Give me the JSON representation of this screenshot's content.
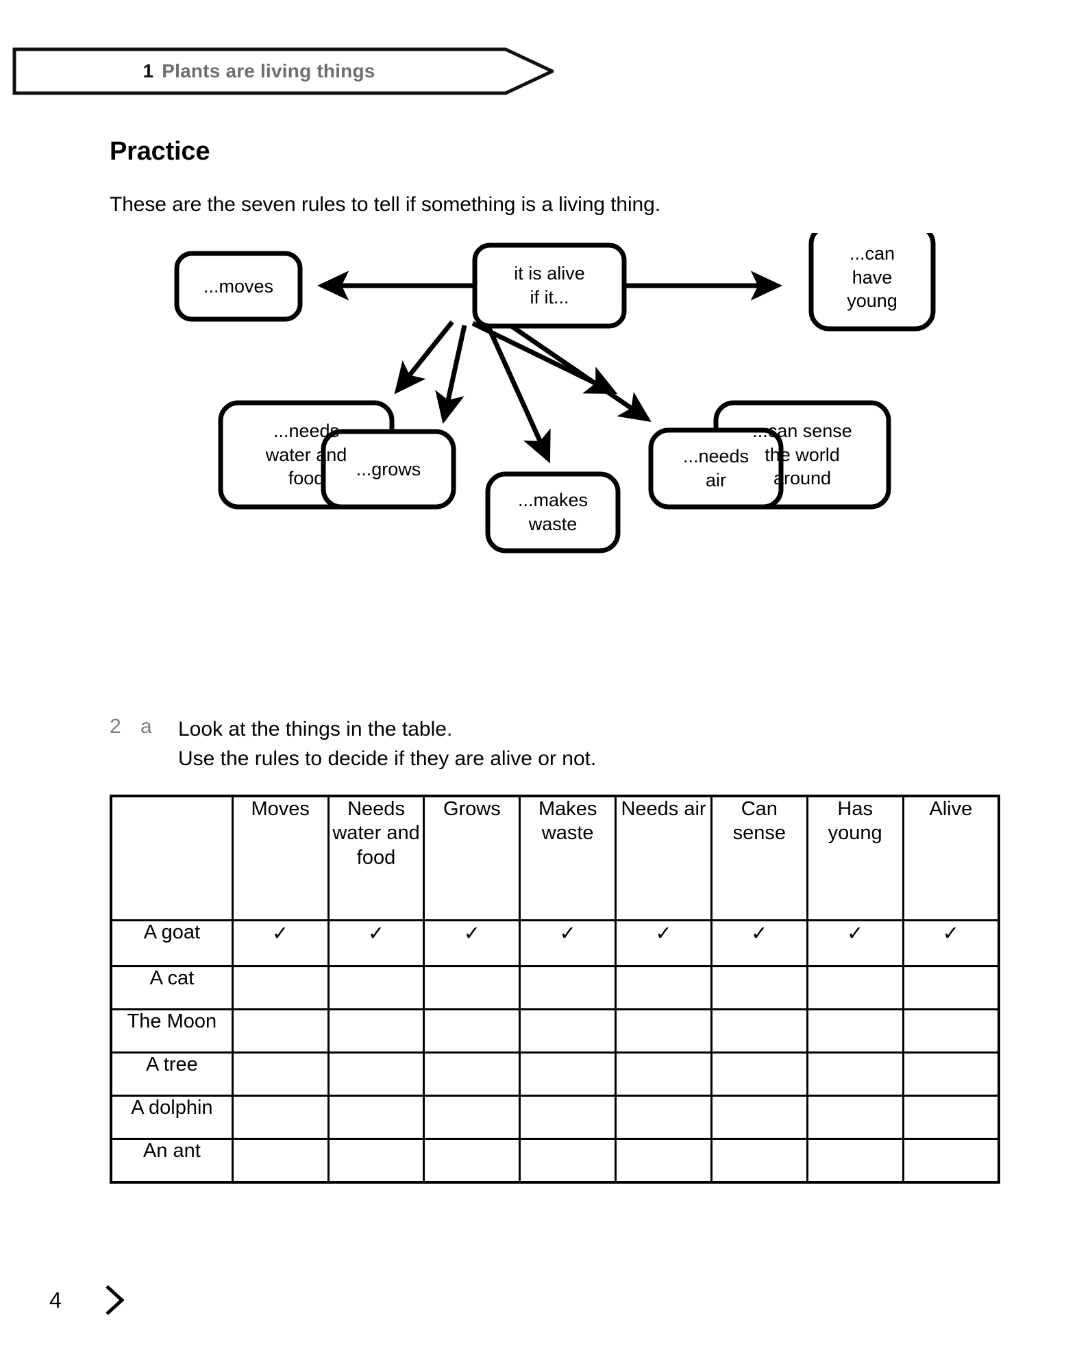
{
  "banner": {
    "chapter_number": "1",
    "chapter_title": "Plants are living things"
  },
  "section": {
    "heading": "Practice",
    "intro": "These are the seven rules to tell if something is a living thing."
  },
  "diagram": {
    "center": "it is alive\nif it...",
    "center_line1": "it is alive",
    "center_line2": "if it...",
    "nodes": [
      {
        "id": "moves",
        "label": "...moves"
      },
      {
        "id": "can-have-young",
        "label": "...can\nhave\nyoung"
      },
      {
        "id": "needs-water-and-food",
        "label": "...needs\nwater and\nfood"
      },
      {
        "id": "can-sense-the-world-around",
        "label": "...can sense\nthe world\naround"
      },
      {
        "id": "grows",
        "label": "...grows"
      },
      {
        "id": "makes-waste",
        "label": "...makes\nwaste"
      },
      {
        "id": "needs-air",
        "label": "...needs\nair"
      }
    ]
  },
  "question": {
    "number": "2",
    "letter": "a",
    "line1": "Look at the things in the table.",
    "line2": "Use the rules to decide if they are alive or not."
  },
  "table": {
    "corner_label": "",
    "columns": [
      "Moves",
      "Needs water and food",
      "Grows",
      "Makes waste",
      "Needs air",
      "Can sense",
      "Has young",
      "Alive"
    ],
    "rows": [
      {
        "label": "A goat",
        "cells": [
          "✓",
          "✓",
          "✓",
          "✓",
          "✓",
          "✓",
          "✓",
          "✓"
        ]
      },
      {
        "label": "A cat",
        "cells": [
          "",
          "",
          "",
          "",
          "",
          "",
          "",
          ""
        ]
      },
      {
        "label": "The Moon",
        "cells": [
          "",
          "",
          "",
          "",
          "",
          "",
          "",
          ""
        ]
      },
      {
        "label": "A tree",
        "cells": [
          "",
          "",
          "",
          "",
          "",
          "",
          "",
          ""
        ]
      },
      {
        "label": "A dolphin",
        "cells": [
          "",
          "",
          "",
          "",
          "",
          "",
          "",
          ""
        ]
      },
      {
        "label": "An ant",
        "cells": [
          "",
          "",
          "",
          "",
          "",
          "",
          "",
          ""
        ]
      }
    ]
  },
  "footer": {
    "page_number": "4"
  },
  "colors": {
    "header_fill": "#bfbfbf",
    "banner_title": "#6e6e6e",
    "ink": "#000000"
  }
}
